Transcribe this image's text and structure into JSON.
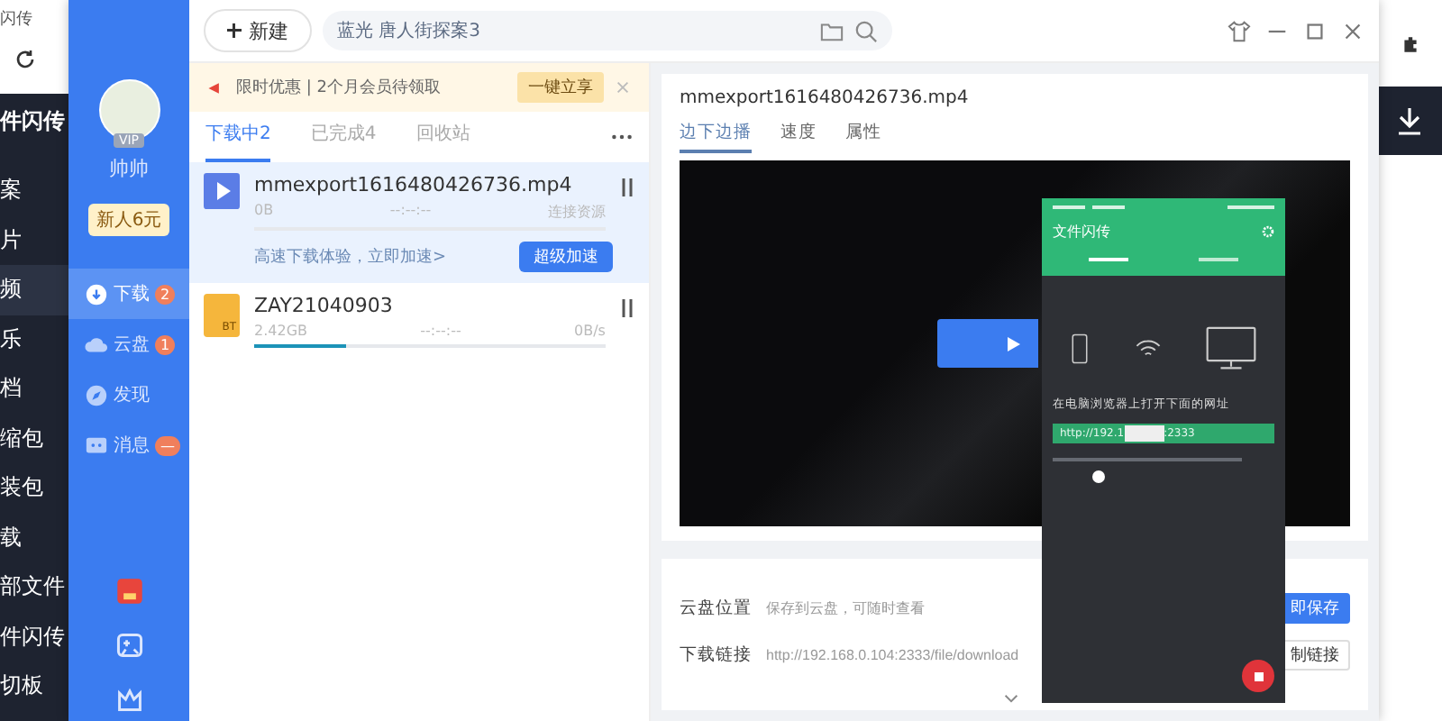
{
  "browser": {
    "tab_title": "闪传",
    "sidebar_title": "件闪传",
    "sidebar_items": [
      {
        "label": "案",
        "selected": false
      },
      {
        "label": "片",
        "selected": false
      },
      {
        "label": "频",
        "selected": true
      },
      {
        "label": "乐",
        "selected": false
      },
      {
        "label": "档",
        "selected": false
      },
      {
        "label": "缩包",
        "selected": false
      },
      {
        "label": "装包",
        "selected": false
      },
      {
        "label": "载",
        "selected": false
      },
      {
        "label": "部文件",
        "selected": false
      },
      {
        "label": "件闪传",
        "selected": false
      },
      {
        "label": "切板",
        "selected": false
      }
    ]
  },
  "app": {
    "toolbar": {
      "new_button": "新建",
      "search": {
        "value": "蓝光  唐人街探案3"
      }
    },
    "profile": {
      "vip": "VIP",
      "name": "帅帅",
      "coupon": "新人6元"
    },
    "nav": [
      {
        "kind": "download",
        "label": "下载",
        "badge": "2",
        "selected": true
      },
      {
        "kind": "cloud",
        "label": "云盘",
        "badge": "1",
        "selected": false
      },
      {
        "kind": "discover",
        "label": "发现",
        "selected": false
      },
      {
        "kind": "message",
        "label": "消息",
        "badge": "—",
        "selected": false
      }
    ],
    "promo": {
      "text": "限时优惠 | 2个月会员待领取",
      "button": "一键立享"
    },
    "tabs": [
      {
        "label": "下载中",
        "count": "2",
        "selected": true
      },
      {
        "label": "已完成",
        "count": "4",
        "selected": false
      },
      {
        "label": "回收站",
        "selected": false
      }
    ],
    "downloads": [
      {
        "kind": "video",
        "name": "mmexport1616480426736.mp4",
        "size": "0B",
        "time": "--:--:--",
        "status": "连接资源",
        "level": 0,
        "selected": true,
        "boost_text": "高速下载体验，立即加速>",
        "boost_button": "超级加速"
      },
      {
        "kind": "bt",
        "name": "ZAY21040903",
        "icon_label": "BT",
        "size": "2.42GB",
        "time": "--:--:--",
        "status": "0B/s",
        "level": 0.26,
        "selected": false
      }
    ],
    "detail": {
      "title": "mmexport1616480426736.mp4",
      "tabs": [
        {
          "label": "边下边播",
          "selected": true
        },
        {
          "label": "速度",
          "selected": false
        },
        {
          "label": "属性",
          "selected": false
        }
      ],
      "rows": [
        {
          "label": "云盘位置",
          "value": "保存到云盘，可随时查看",
          "button": "即保存",
          "primary": true
        },
        {
          "label": "下载链接",
          "value": "http://192.168.0.104:2333/file/download",
          "button": "制链接",
          "primary": false
        }
      ]
    }
  },
  "phone": {
    "title": "文件闪传",
    "instruction": "在电脑浏览器上打开下面的网址",
    "url_start": "http://192.1",
    "url_end": ":2333",
    "toggle": {
      "on": false
    }
  }
}
